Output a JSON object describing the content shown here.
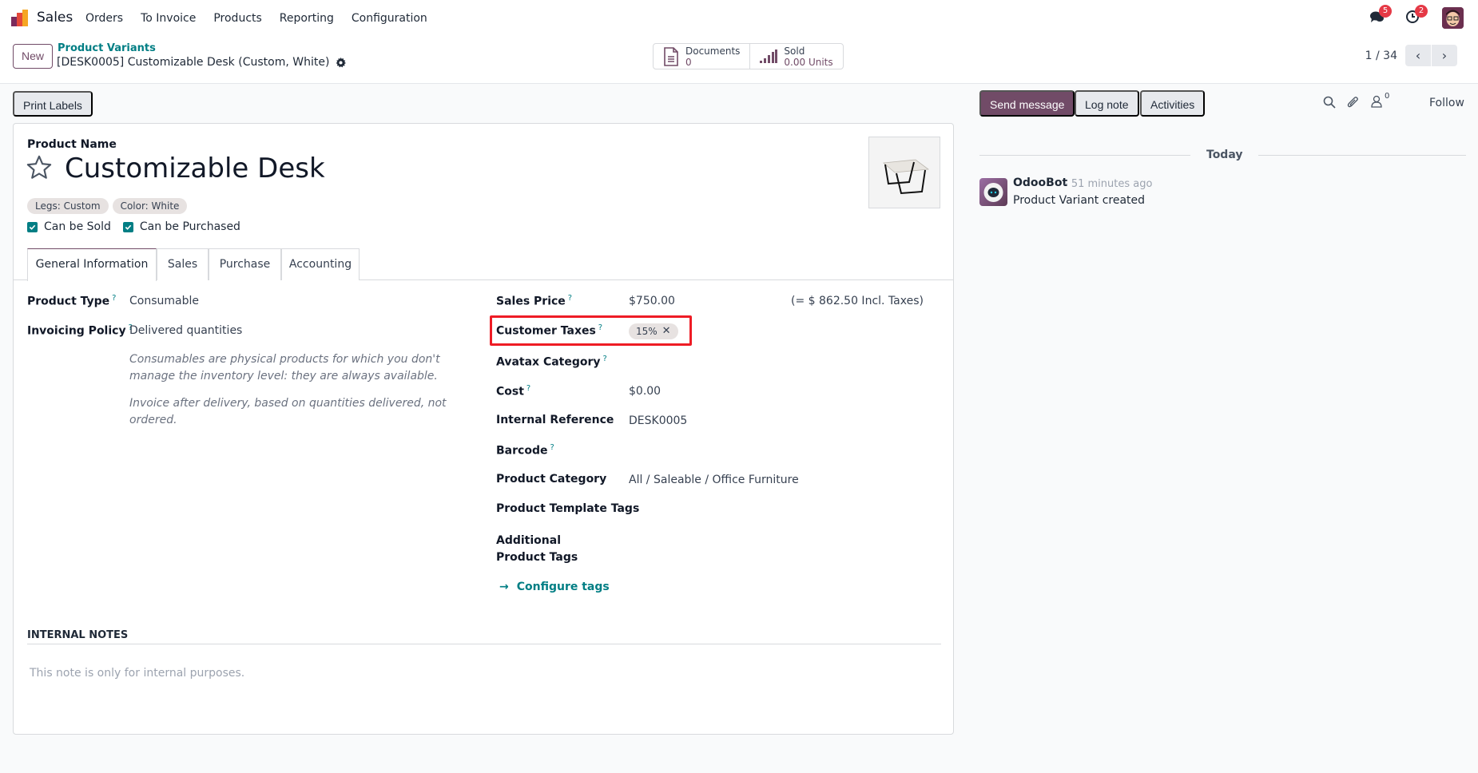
{
  "navbar": {
    "app_name": "Sales",
    "menu": [
      "Orders",
      "To Invoice",
      "Products",
      "Reporting",
      "Configuration"
    ],
    "messages_badge": "5",
    "activities_badge": "2"
  },
  "control_panel": {
    "new_label": "New",
    "breadcrumb_parent": "Product Variants",
    "breadcrumb_current": "[DESK0005] Customizable Desk (Custom, White)",
    "stats": [
      {
        "label": "Documents",
        "value": "0",
        "icon": "document-icon"
      },
      {
        "label": "Sold",
        "value": "0.00 Units",
        "icon": "bar-chart-icon"
      }
    ],
    "pager_value": "1 / 34"
  },
  "actions": {
    "print_labels": "Print Labels"
  },
  "form": {
    "product_name_label": "Product Name",
    "product_name": "Customizable Desk",
    "attribute_tags": [
      "Legs: Custom",
      "Color: White"
    ],
    "checkboxes": [
      {
        "label": "Can be Sold",
        "checked": true
      },
      {
        "label": "Can be Purchased",
        "checked": true
      }
    ],
    "tabs": [
      "General Information",
      "Sales",
      "Purchase",
      "Accounting"
    ],
    "active_tab": "General Information",
    "left_fields": {
      "product_type_label": "Product Type",
      "product_type": "Consumable",
      "invoicing_policy_label": "Invoicing Policy",
      "invoicing_policy": "Delivered quantities",
      "help_consumable": "Consumables are physical products for which you don't manage the inventory level: they are always available.",
      "help_invoice": "Invoice after delivery, based on quantities delivered, not ordered."
    },
    "right_fields": {
      "sales_price_label": "Sales Price",
      "sales_price": "$750.00",
      "sales_price_incl": "(= $ 862.50 Incl. Taxes)",
      "customer_taxes_label": "Customer Taxes",
      "customer_taxes": "15%",
      "avatax_label": "Avatax Category",
      "cost_label": "Cost",
      "cost": "$0.00",
      "internal_ref_label": "Internal Reference",
      "internal_ref": "DESK0005",
      "barcode_label": "Barcode",
      "category_label": "Product Category",
      "category": "All / Saleable / Office Furniture",
      "template_tags_label": "Product Template Tags",
      "additional_tags_label": "Additional Product Tags",
      "configure_tags": "Configure tags"
    },
    "help_marker": "?",
    "internal_notes_title": "INTERNAL NOTES",
    "internal_notes_placeholder": "This note is only for internal purposes."
  },
  "chatter": {
    "send_message": "Send message",
    "log_note": "Log note",
    "activities": "Activities",
    "followers_count": "0",
    "follow": "Follow",
    "date_separator": "Today",
    "messages": [
      {
        "author": "OdooBot",
        "time": "- 51 minutes ago",
        "body": "Product Variant created"
      }
    ]
  },
  "colors": {
    "brand": "#714b67",
    "link": "#017e84",
    "highlight": "#ee1c25"
  }
}
